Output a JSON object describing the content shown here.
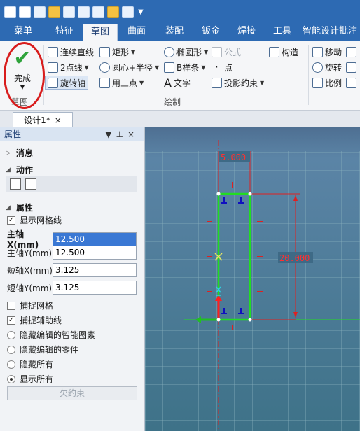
{
  "menu": {
    "tabs": [
      "菜单",
      "特征",
      "草图",
      "曲面",
      "装配",
      "钣金",
      "焊接",
      "工具",
      "智能设计批注"
    ],
    "active_index": 2
  },
  "ribbon": {
    "finish_label": "完成",
    "group_sketch_label": "草图",
    "group_draw_label": "绘制",
    "tools": {
      "polyline": "连续直线",
      "rect": "矩形",
      "ellipse": "椭圆形",
      "formula": "公式",
      "construct": "构造",
      "two_point": "2点线",
      "center_radius": "圆心+半径",
      "bspline": "B样条",
      "point": "点",
      "rotate_axis": "旋转轴",
      "three_point": "用三点",
      "text": "文字",
      "projection": "投影约束",
      "move": "移动",
      "rotate": "旋转",
      "scale": "比例"
    }
  },
  "doc_tab": {
    "label": "设计1*",
    "close": "×"
  },
  "panel": {
    "title": "属性",
    "sections": {
      "message": "消息",
      "action": "动作",
      "properties": "属性"
    },
    "show_grid": "显示网格线",
    "fields": [
      {
        "label": "主轴X(mm)",
        "value": "12.500"
      },
      {
        "label": "主轴Y(mm)",
        "value": "12.500"
      },
      {
        "label": "短轴X(mm)",
        "value": "3.125"
      },
      {
        "label": "短轴Y(mm)",
        "value": "3.125"
      }
    ],
    "snap_grid": "捕捉网格",
    "snap_aux": "捕捉辅助线",
    "radios": [
      "隐藏编辑的智能图素",
      "隐藏编辑的零件",
      "隐藏所有",
      "显示所有"
    ],
    "selected_radio": 3,
    "under_constraint": "欠约束"
  },
  "sketch": {
    "dim_width": "5.000",
    "dim_height": "20.000"
  },
  "colors": {
    "title_bar": "#2d6ab3",
    "sketch_green": "#22dd22",
    "dimension_red": "#e02020",
    "grid_bg": "#4a7c96"
  }
}
